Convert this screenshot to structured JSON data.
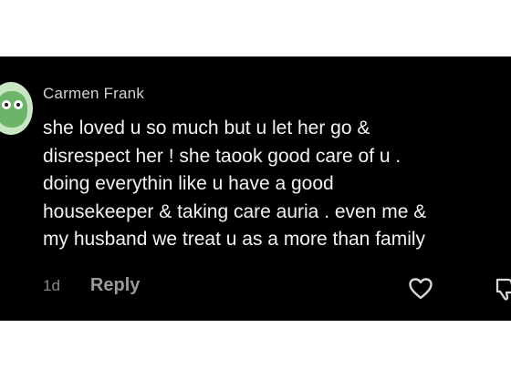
{
  "comment": {
    "username": "Carmen Frank",
    "lines": [
      "she loved u so much but u let her go &",
      "disrespect her ! she taook good care of u .",
      "doing everythin like u have a good",
      "housekeeper & taking care auria . even me &",
      "my husband we treat u as a more than family"
    ],
    "timestamp": "1d",
    "reply_label": "Reply"
  },
  "icons": {
    "avatar": "frog-avatar",
    "like": "heart-outline-icon",
    "dislike": "thumbs-down-icon"
  },
  "colors": {
    "card_background": "#000000",
    "text": "#f2f2f2",
    "username": "#d3d3d3",
    "muted": "#8a8a8a"
  }
}
